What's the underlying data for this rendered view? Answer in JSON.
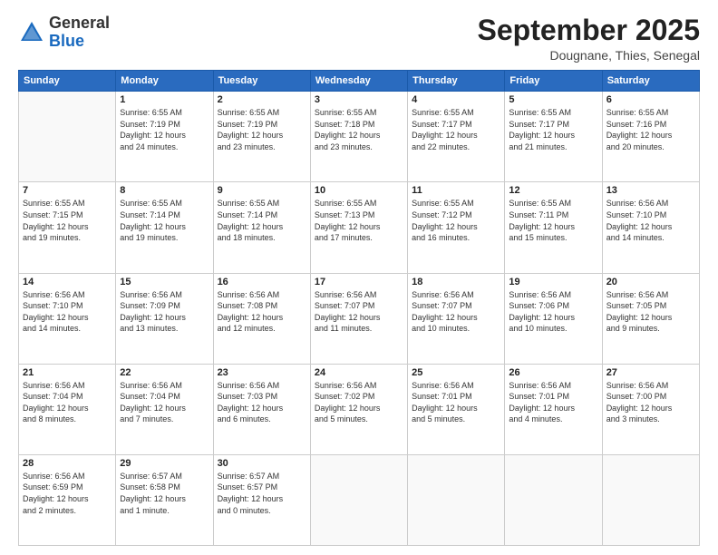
{
  "header": {
    "logo": {
      "line1": "General",
      "line2": "Blue"
    },
    "title": "September 2025",
    "location": "Dougnane, Thies, Senegal"
  },
  "calendar": {
    "days_of_week": [
      "Sunday",
      "Monday",
      "Tuesday",
      "Wednesday",
      "Thursday",
      "Friday",
      "Saturday"
    ],
    "weeks": [
      [
        {
          "day": "",
          "info": ""
        },
        {
          "day": "1",
          "info": "Sunrise: 6:55 AM\nSunset: 7:19 PM\nDaylight: 12 hours\nand 24 minutes."
        },
        {
          "day": "2",
          "info": "Sunrise: 6:55 AM\nSunset: 7:19 PM\nDaylight: 12 hours\nand 23 minutes."
        },
        {
          "day": "3",
          "info": "Sunrise: 6:55 AM\nSunset: 7:18 PM\nDaylight: 12 hours\nand 23 minutes."
        },
        {
          "day": "4",
          "info": "Sunrise: 6:55 AM\nSunset: 7:17 PM\nDaylight: 12 hours\nand 22 minutes."
        },
        {
          "day": "5",
          "info": "Sunrise: 6:55 AM\nSunset: 7:17 PM\nDaylight: 12 hours\nand 21 minutes."
        },
        {
          "day": "6",
          "info": "Sunrise: 6:55 AM\nSunset: 7:16 PM\nDaylight: 12 hours\nand 20 minutes."
        }
      ],
      [
        {
          "day": "7",
          "info": "Sunrise: 6:55 AM\nSunset: 7:15 PM\nDaylight: 12 hours\nand 19 minutes."
        },
        {
          "day": "8",
          "info": "Sunrise: 6:55 AM\nSunset: 7:14 PM\nDaylight: 12 hours\nand 19 minutes."
        },
        {
          "day": "9",
          "info": "Sunrise: 6:55 AM\nSunset: 7:14 PM\nDaylight: 12 hours\nand 18 minutes."
        },
        {
          "day": "10",
          "info": "Sunrise: 6:55 AM\nSunset: 7:13 PM\nDaylight: 12 hours\nand 17 minutes."
        },
        {
          "day": "11",
          "info": "Sunrise: 6:55 AM\nSunset: 7:12 PM\nDaylight: 12 hours\nand 16 minutes."
        },
        {
          "day": "12",
          "info": "Sunrise: 6:55 AM\nSunset: 7:11 PM\nDaylight: 12 hours\nand 15 minutes."
        },
        {
          "day": "13",
          "info": "Sunrise: 6:56 AM\nSunset: 7:10 PM\nDaylight: 12 hours\nand 14 minutes."
        }
      ],
      [
        {
          "day": "14",
          "info": "Sunrise: 6:56 AM\nSunset: 7:10 PM\nDaylight: 12 hours\nand 14 minutes."
        },
        {
          "day": "15",
          "info": "Sunrise: 6:56 AM\nSunset: 7:09 PM\nDaylight: 12 hours\nand 13 minutes."
        },
        {
          "day": "16",
          "info": "Sunrise: 6:56 AM\nSunset: 7:08 PM\nDaylight: 12 hours\nand 12 minutes."
        },
        {
          "day": "17",
          "info": "Sunrise: 6:56 AM\nSunset: 7:07 PM\nDaylight: 12 hours\nand 11 minutes."
        },
        {
          "day": "18",
          "info": "Sunrise: 6:56 AM\nSunset: 7:07 PM\nDaylight: 12 hours\nand 10 minutes."
        },
        {
          "day": "19",
          "info": "Sunrise: 6:56 AM\nSunset: 7:06 PM\nDaylight: 12 hours\nand 10 minutes."
        },
        {
          "day": "20",
          "info": "Sunrise: 6:56 AM\nSunset: 7:05 PM\nDaylight: 12 hours\nand 9 minutes."
        }
      ],
      [
        {
          "day": "21",
          "info": "Sunrise: 6:56 AM\nSunset: 7:04 PM\nDaylight: 12 hours\nand 8 minutes."
        },
        {
          "day": "22",
          "info": "Sunrise: 6:56 AM\nSunset: 7:04 PM\nDaylight: 12 hours\nand 7 minutes."
        },
        {
          "day": "23",
          "info": "Sunrise: 6:56 AM\nSunset: 7:03 PM\nDaylight: 12 hours\nand 6 minutes."
        },
        {
          "day": "24",
          "info": "Sunrise: 6:56 AM\nSunset: 7:02 PM\nDaylight: 12 hours\nand 5 minutes."
        },
        {
          "day": "25",
          "info": "Sunrise: 6:56 AM\nSunset: 7:01 PM\nDaylight: 12 hours\nand 5 minutes."
        },
        {
          "day": "26",
          "info": "Sunrise: 6:56 AM\nSunset: 7:01 PM\nDaylight: 12 hours\nand 4 minutes."
        },
        {
          "day": "27",
          "info": "Sunrise: 6:56 AM\nSunset: 7:00 PM\nDaylight: 12 hours\nand 3 minutes."
        }
      ],
      [
        {
          "day": "28",
          "info": "Sunrise: 6:56 AM\nSunset: 6:59 PM\nDaylight: 12 hours\nand 2 minutes."
        },
        {
          "day": "29",
          "info": "Sunrise: 6:57 AM\nSunset: 6:58 PM\nDaylight: 12 hours\nand 1 minute."
        },
        {
          "day": "30",
          "info": "Sunrise: 6:57 AM\nSunset: 6:57 PM\nDaylight: 12 hours\nand 0 minutes."
        },
        {
          "day": "",
          "info": ""
        },
        {
          "day": "",
          "info": ""
        },
        {
          "day": "",
          "info": ""
        },
        {
          "day": "",
          "info": ""
        }
      ]
    ]
  }
}
